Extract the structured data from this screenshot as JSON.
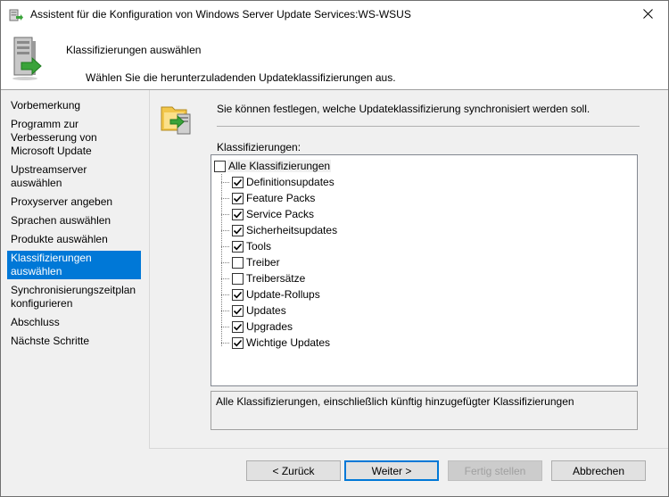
{
  "window": {
    "title": "Assistent für die Konfiguration von Windows Server Update Services:WS-WSUS",
    "close_glyph": "✕"
  },
  "header": {
    "title": "Klassifizierungen auswählen",
    "subtitle": "Wählen Sie die herunterzuladenden Updateklassifizierungen aus."
  },
  "nav": {
    "items": [
      {
        "label": "Vorbemerkung"
      },
      {
        "label": "Programm zur Verbesserung von Microsoft Update"
      },
      {
        "label": "Upstreamserver auswählen"
      },
      {
        "label": "Proxyserver angeben"
      },
      {
        "label": "Sprachen auswählen"
      },
      {
        "label": "Produkte auswählen"
      },
      {
        "label": "Klassifizierungen auswählen",
        "selected": true
      },
      {
        "label": "Synchronisierungszeitplan konfigurieren"
      },
      {
        "label": "Abschluss"
      },
      {
        "label": "Nächste Schritte"
      }
    ]
  },
  "main": {
    "intro": "Sie können festlegen, welche Updateklassifizierung synchronisiert werden soll.",
    "list_label": "Klassifizierungen:",
    "root": {
      "label": "Alle Klassifizierungen",
      "checked": false
    },
    "items": [
      {
        "label": "Definitionsupdates",
        "checked": true
      },
      {
        "label": "Feature Packs",
        "checked": true
      },
      {
        "label": "Service Packs",
        "checked": true
      },
      {
        "label": "Sicherheitsupdates",
        "checked": true
      },
      {
        "label": "Tools",
        "checked": true
      },
      {
        "label": "Treiber",
        "checked": false
      },
      {
        "label": "Treibersätze",
        "checked": false
      },
      {
        "label": "Update-Rollups",
        "checked": true
      },
      {
        "label": "Updates",
        "checked": true
      },
      {
        "label": "Upgrades",
        "checked": true
      },
      {
        "label": "Wichtige Updates",
        "checked": true
      }
    ],
    "description": "Alle Klassifizierungen, einschließlich künftig hinzugefügter Klassifizierungen"
  },
  "buttons": {
    "back": "< Zurück",
    "next": "Weiter >",
    "finish": "Fertig stellen",
    "cancel": "Abbrechen"
  },
  "colors": {
    "selection": "#0078d7",
    "window_bg": "#f0f0f0"
  },
  "icons": {
    "title": "server-update-icon",
    "header": "server-tower-icon",
    "intro": "folder-update-icon",
    "close": "close-icon"
  }
}
